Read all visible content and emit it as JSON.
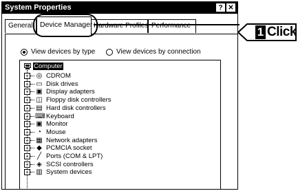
{
  "window": {
    "title": "System Properties",
    "help_button": "?",
    "close_button": "✕"
  },
  "tabs": [
    {
      "label": "General"
    },
    {
      "label": "Device Manager"
    },
    {
      "label": "Hardware Profiles"
    },
    {
      "label": "Performance"
    }
  ],
  "view_options": {
    "by_type": "View devices by type",
    "by_connection": "View devices by connection",
    "selected": "by_type"
  },
  "tree": {
    "root": "Computer",
    "items": [
      {
        "label": "CDROM",
        "icon": "cd-icon"
      },
      {
        "label": "Disk drives",
        "icon": "disk-icon"
      },
      {
        "label": "Display adapters",
        "icon": "monitor-icon"
      },
      {
        "label": "Floppy disk controllers",
        "icon": "floppy-icon"
      },
      {
        "label": "Hard disk controllers",
        "icon": "harddisk-icon"
      },
      {
        "label": "Keyboard",
        "icon": "keyboard-icon"
      },
      {
        "label": "Monitor",
        "icon": "monitor-icon"
      },
      {
        "label": "Mouse",
        "icon": "mouse-icon"
      },
      {
        "label": "Network adapters",
        "icon": "network-icon"
      },
      {
        "label": "PCMCIA socket",
        "icon": "pcmcia-icon"
      },
      {
        "label": "Ports (COM & LPT)",
        "icon": "port-icon"
      },
      {
        "label": "SCSI controllers",
        "icon": "scsi-icon"
      },
      {
        "label": "System devices",
        "icon": "system-icon"
      }
    ]
  },
  "callout": {
    "number": "1",
    "text": "Click"
  }
}
